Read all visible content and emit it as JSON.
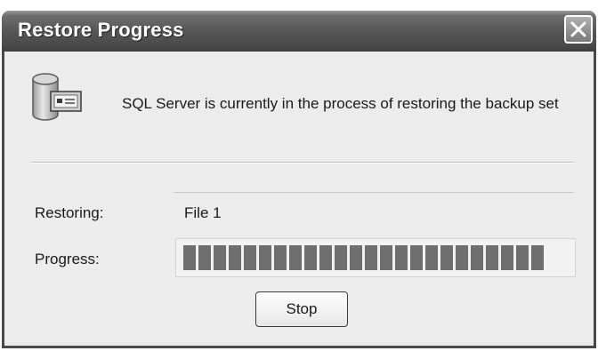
{
  "window": {
    "title": "Restore Progress"
  },
  "icons": {
    "close": "close-icon",
    "status": "database-icon"
  },
  "message": "SQL Server is currently in the process of restoring the backup set",
  "restoring": {
    "label": "Restoring:",
    "value": "File 1"
  },
  "progress": {
    "label": "Progress:",
    "fraction": 0.95
  },
  "buttons": {
    "stop_label": "Stop"
  }
}
